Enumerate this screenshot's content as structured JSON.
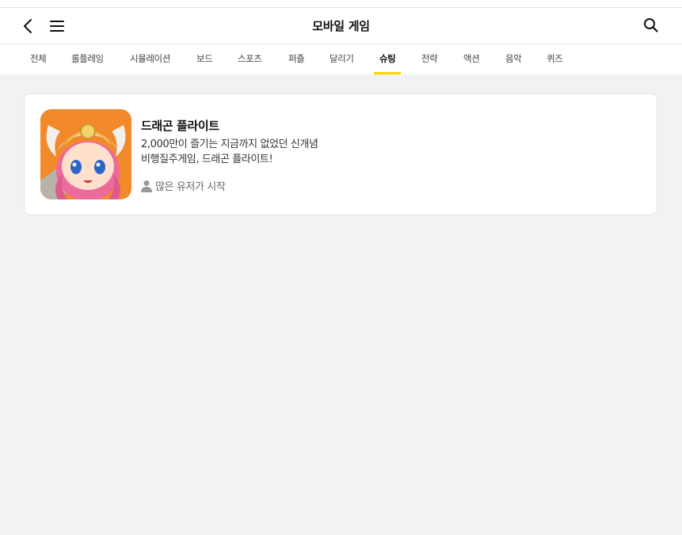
{
  "header": {
    "title": "모바일 게임"
  },
  "tabs": [
    {
      "label": "전체"
    },
    {
      "label": "롤플레잉"
    },
    {
      "label": "시뮬레이션"
    },
    {
      "label": "보드"
    },
    {
      "label": "스포츠"
    },
    {
      "label": "퍼즐"
    },
    {
      "label": "달리기"
    },
    {
      "label": "슈팅",
      "active": true
    },
    {
      "label": "전략"
    },
    {
      "label": "액션"
    },
    {
      "label": "음악"
    },
    {
      "label": "퀴즈"
    }
  ],
  "game": {
    "name": "드래곤 플라이트",
    "desc_line1": "2,000만이 즐기는 지금까지 없었던 신개념",
    "desc_line2": "비행질주게임, 드래곤 플라이트!",
    "users": "많은 유저가 시작"
  },
  "colors": {
    "accent": "#f5d800",
    "background": "#f2f2f2",
    "thumb_bg": "#f28a2b"
  },
  "icons": [
    "back-arrow-icon",
    "hamburger-menu-icon",
    "search-icon",
    "person-icon"
  ]
}
